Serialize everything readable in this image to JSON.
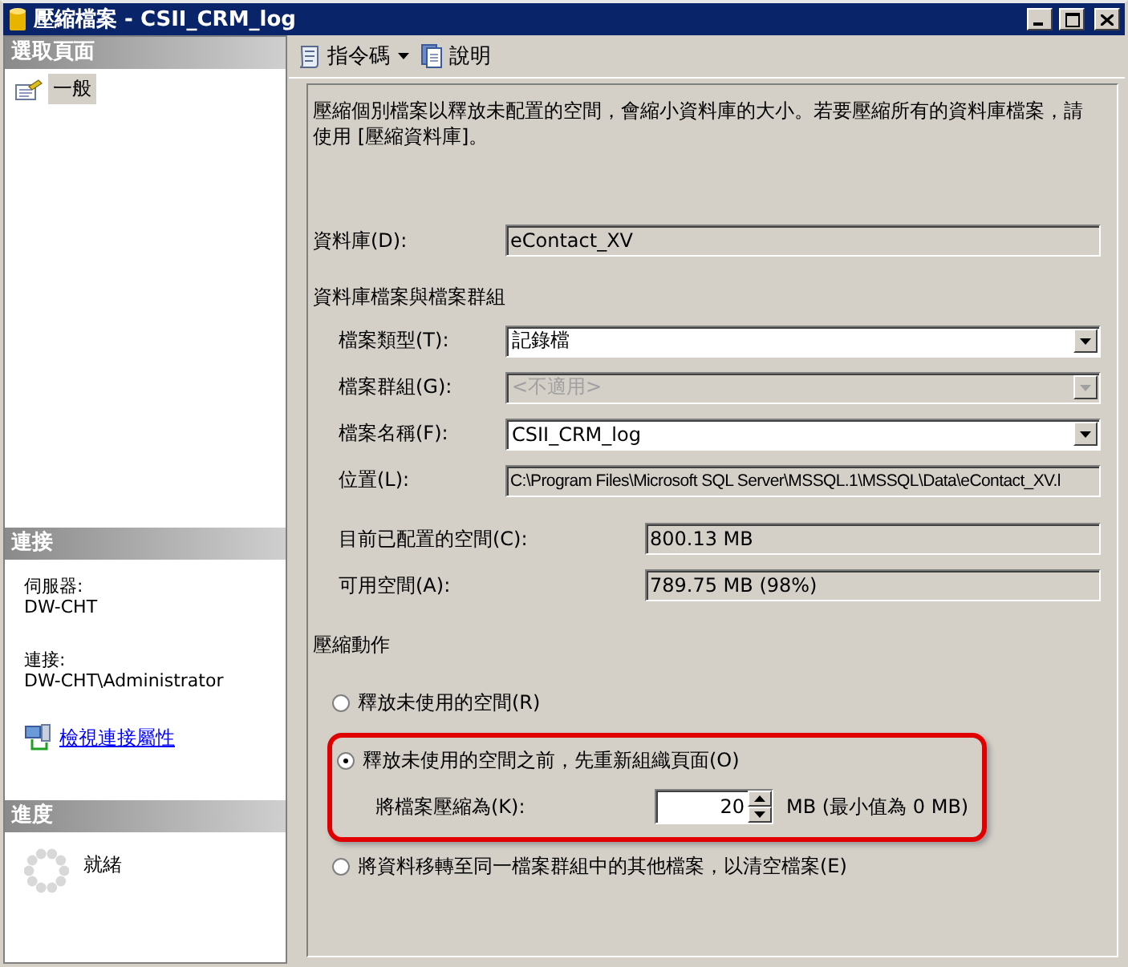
{
  "window": {
    "title": "壓縮檔案 - CSII_CRM_log"
  },
  "sidebar": {
    "pages": {
      "header": "選取頁面",
      "items": [
        {
          "label": "一般",
          "selected": true
        }
      ]
    },
    "connection": {
      "header": "連接",
      "server_label": "伺服器:",
      "server": "DW-CHT",
      "connection_label": "連接:",
      "connection": "DW-CHT\\Administrator",
      "link": "檢視連接屬性"
    },
    "progress": {
      "header": "進度",
      "status": "就緒"
    }
  },
  "toolbar": [
    {
      "label": "指令碼",
      "kind": "script"
    },
    {
      "label": "說明",
      "kind": "help"
    }
  ],
  "description": "壓縮個別檔案以釋放未配置的空間，會縮小資料庫的大小。若要壓縮所有的資料庫檔案，請使用 [壓縮資料庫]。",
  "database": {
    "label": "資料庫(D):",
    "value": "eContact_XV"
  },
  "files_group": {
    "title": "資料庫檔案與檔案群組",
    "fields": [
      {
        "label": "檔案類型(T):",
        "value": "記錄檔",
        "kind": "dropdown",
        "disabled": false
      },
      {
        "label": "檔案群組(G):",
        "value": "<不適用>",
        "kind": "dropdown",
        "disabled": true
      },
      {
        "label": "檔案名稱(F):",
        "value": "CSII_CRM_log",
        "kind": "dropdown",
        "disabled": false
      },
      {
        "label": "位置(L):",
        "value": "C:\\Program Files\\Microsoft SQL Server\\MSSQL.1\\MSSQL\\Data\\eContact_XV.l",
        "kind": "readonly"
      }
    ],
    "space": [
      {
        "label": "目前已配置的空間(C):",
        "value": "800.13 MB"
      },
      {
        "label": "可用空間(A):",
        "value": "789.75 MB (98%)"
      }
    ]
  },
  "shrink_action": {
    "title": "壓縮動作",
    "options": [
      {
        "label": "釋放未使用的空間(R)",
        "selected": false,
        "highlighted": false
      },
      {
        "label": "釋放未使用的空間之前，先重新組織頁面(O)",
        "selected": true,
        "highlighted": true,
        "shrink_to": {
          "label": "將檔案壓縮為(K):",
          "value": "20",
          "unit": "MB (最小值為 0 MB)"
        }
      },
      {
        "label": "將資料移轉至同一檔案群組中的其他檔案，以清空檔案(E)",
        "selected": false,
        "highlighted": false
      }
    ]
  }
}
